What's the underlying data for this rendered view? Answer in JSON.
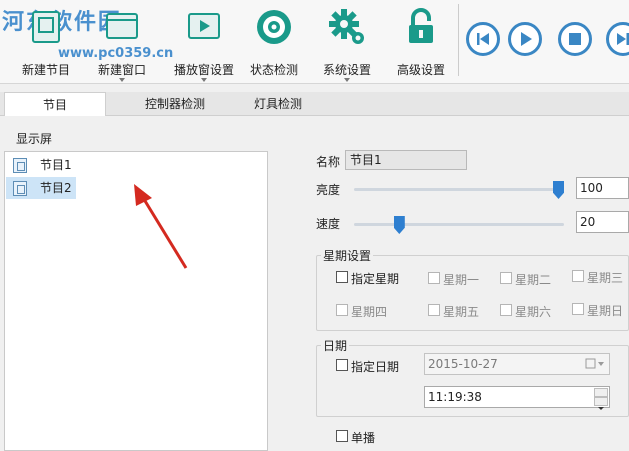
{
  "toolbar": {
    "items": [
      {
        "label": "新建节目",
        "icon": "new-program-icon"
      },
      {
        "label": "新建窗口",
        "icon": "new-window-icon"
      },
      {
        "label": "播放窗设置",
        "icon": "play-window-settings-icon"
      },
      {
        "label": "状态检测",
        "icon": "status-check-icon"
      },
      {
        "label": "系统设置",
        "icon": "gear-icon"
      },
      {
        "label": "高级设置",
        "icon": "lock-icon"
      }
    ],
    "watermark_name": "河东软件园",
    "watermark_url": "www.pc0359.cn"
  },
  "tabs": [
    "节目",
    "控制器检测",
    "灯具检测"
  ],
  "left_panel": {
    "title": "显示屏",
    "items": [
      "节目1",
      "节目2"
    ]
  },
  "props": {
    "name_label": "名称",
    "name_value": "节目1",
    "brightness_label": "亮度",
    "brightness_value": "100",
    "brightness_level": 1.0,
    "speed_label": "速度",
    "speed_value": "20",
    "speed_level": 0.2,
    "week_group_title": "星期设置",
    "specify_week": "指定星期",
    "weekdays": [
      "星期一",
      "星期二",
      "星期三",
      "星期四",
      "星期五",
      "星期六",
      "星期日"
    ],
    "date_group_title": "日期",
    "specify_date": "指定日期",
    "date_value": "2015-10-27",
    "time_value": "11:19:38",
    "single_play": "单播"
  },
  "colors": {
    "accent": "#2e7fd0",
    "media": "#3a87c4",
    "icon_teal": "#1a9a8a",
    "arrow": "#d42a20"
  }
}
